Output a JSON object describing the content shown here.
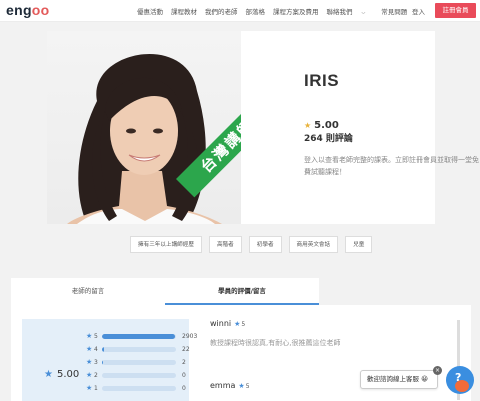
{
  "header": {
    "logo_prefix": "eng",
    "logo_o1": "o",
    "logo_o2": "o",
    "nav": [
      "優惠活動",
      "課程教材",
      "我們的老師",
      "部落格",
      "課程方案及費用",
      "聯絡我們",
      "常見問題"
    ],
    "login": "登入",
    "signup": "註冊會員"
  },
  "profile": {
    "name": "IRIS",
    "rating": "5.00",
    "review_count": "264 則評論",
    "description": "登入以查看老師完整的課表。立即註冊會員並取得一堂免費試聽課程！",
    "ribbon": "台灣講師"
  },
  "tags": [
    "擁有三年以上講師經歷",
    "高階者",
    "初學者",
    "商用英文會話",
    "兒童"
  ],
  "tabs": {
    "teacher_message": "老師的留言",
    "student_reviews": "學員的評價/留言"
  },
  "summary": {
    "average": "5.00",
    "distribution": [
      {
        "stars": "5",
        "count": "2903",
        "fraction": 0.99
      },
      {
        "stars": "4",
        "count": "22",
        "fraction": 0.03
      },
      {
        "stars": "3",
        "count": "2",
        "fraction": 0.005
      },
      {
        "stars": "2",
        "count": "0",
        "fraction": 0
      },
      {
        "stars": "1",
        "count": "0",
        "fraction": 0
      }
    ]
  },
  "reviews": [
    {
      "name": "winni",
      "rating": "5",
      "text": "教授課程時很認真,有耐心,很推薦這位老師"
    },
    {
      "name": "emma",
      "rating": "5"
    }
  ],
  "chat": {
    "label": "歡迎諮詢線上客服 😀",
    "close": "×",
    "help": "?"
  },
  "colors": {
    "accent": "#e94b5a",
    "brand_blue": "#4a8fd8",
    "ribbon_green": "#2ca64c",
    "star_gold": "#e8b23a"
  }
}
